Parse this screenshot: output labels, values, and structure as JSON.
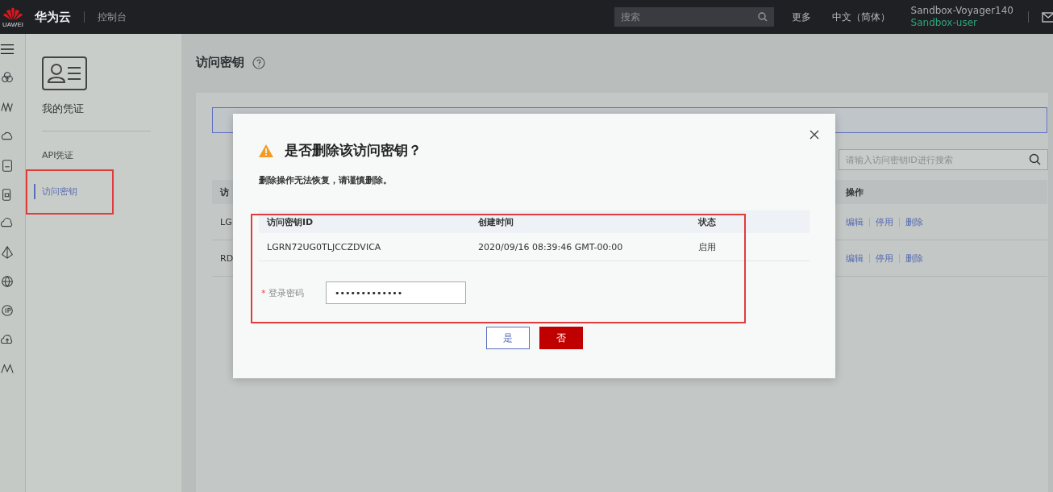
{
  "topbar": {
    "logo_text": "UAWEI",
    "brand": "华为云",
    "console": "控制台",
    "search": {
      "placeholder": "搜索"
    },
    "links": [
      "更多",
      "中文（简体）"
    ],
    "account": "Sandbox-Voyager140",
    "user": "Sandbox-user"
  },
  "sidebar": {
    "title": "我的凭证",
    "items": [
      {
        "label": "API凭证",
        "selected": false,
        "highlighted": false
      },
      {
        "label": "访问密钥",
        "selected": true,
        "highlighted": true
      }
    ]
  },
  "page": {
    "title": "访问密钥",
    "search": {
      "placeholder": "请输入访问密钥ID进行搜索"
    },
    "table": {
      "columns": [
        "访",
        "操作"
      ],
      "rows": [
        {
          "cell": "LG",
          "actions": [
            "编辑",
            "停用",
            "删除"
          ]
        },
        {
          "cell": "RD",
          "actions": [
            "编辑",
            "停用",
            "删除"
          ]
        }
      ]
    }
  },
  "dialog": {
    "title": "是否删除该访问密钥？",
    "message": "删除操作无法恢复，请谨慎删除。",
    "columns": [
      "访问密钥ID",
      "创建时间",
      "状态"
    ],
    "rows": [
      [
        "LGRN72UG0TLJCCZDVICA",
        "2020/09/16 08:39:46 GMT-00:00",
        "启用"
      ]
    ],
    "password": {
      "label": "登录密码",
      "required_mark": "*",
      "value": "•••••••••••••"
    },
    "buttons": [
      {
        "label": "是",
        "kind": "secondary"
      },
      {
        "label": "否",
        "kind": "primary"
      }
    ]
  }
}
